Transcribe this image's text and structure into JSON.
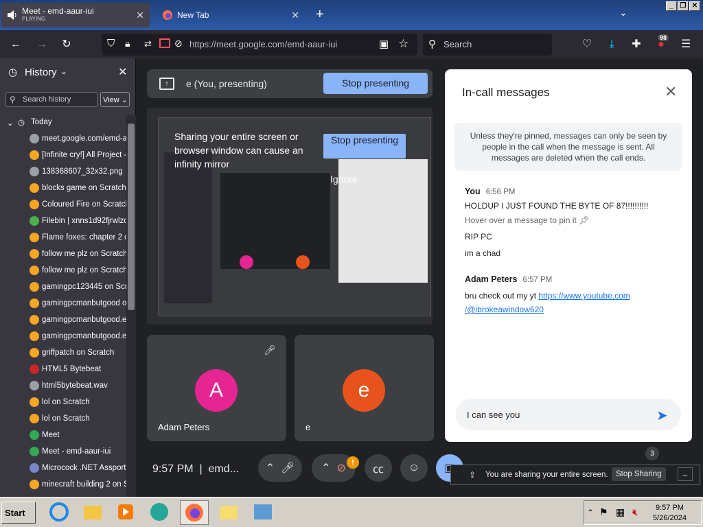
{
  "browser": {
    "tabs": [
      {
        "title": "Meet - emd-aaur-iui",
        "subtitle": "PLAYING"
      },
      {
        "title": "New Tab",
        "subtitle": ""
      }
    ],
    "url": "https://meet.google.com/emd-aaur-iui",
    "search_placeholder": "Search",
    "extension_badge": "98"
  },
  "sidebar": {
    "title": "History",
    "search_placeholder": "Search history",
    "view_label": "View",
    "group_label": "Today",
    "items": [
      {
        "label": "meet.google.com/emd-aa",
        "color": "#9aa0a6"
      },
      {
        "label": "[Infinite cry!] All Project -",
        "color": "#f5a623"
      },
      {
        "label": "138368607_32x32.png",
        "color": "#9aa0a6"
      },
      {
        "label": "blocks game on Scratch",
        "color": "#f5a623"
      },
      {
        "label": "Coloured Fire on Scratch",
        "color": "#f5a623"
      },
      {
        "label": "Filebin | xnns1d92fjrwlzo",
        "color": "#4caf50"
      },
      {
        "label": "Flame foxes: chapter 2 o",
        "color": "#f5a623"
      },
      {
        "label": "follow me plz on Scratch",
        "color": "#f5a623"
      },
      {
        "label": "follow me plz on Scratch",
        "color": "#f5a623"
      },
      {
        "label": "gamingpc123445 on Scra",
        "color": "#f5a623"
      },
      {
        "label": "gamingpcmanbutgood on",
        "color": "#f5a623"
      },
      {
        "label": "gamingpcmanbutgood.ex",
        "color": "#f5a623"
      },
      {
        "label": "gamingpcmanbutgood.ex",
        "color": "#f5a623"
      },
      {
        "label": "griffpatch on Scratch",
        "color": "#f5a623"
      },
      {
        "label": "HTML5 Bytebeat",
        "color": "#c62828"
      },
      {
        "label": "html5bytebeat.wav",
        "color": "#9aa0a6"
      },
      {
        "label": "lol on Scratch",
        "color": "#f5a623"
      },
      {
        "label": "lol on Scratch",
        "color": "#f5a623"
      },
      {
        "label": "Meet",
        "color": "#34a853"
      },
      {
        "label": "Meet - emd-aaur-iui",
        "color": "#34a853"
      },
      {
        "label": "Microcock .NET Assport:",
        "color": "#7986cb"
      },
      {
        "label": "minecraft building 2 on Sc",
        "color": "#f5a623"
      }
    ]
  },
  "meet": {
    "presenting_label": "e (You, presenting)",
    "stop_presenting": "Stop presenting",
    "warning_text": "Sharing your entire screen or browser window can cause an infinity mirror",
    "warning_stop": "Stop presenting",
    "warning_ignore": "Ignore",
    "participants": [
      {
        "name": "Adam Peters",
        "initial": "A",
        "color": "#e52592"
      },
      {
        "name": "e",
        "initial": "e",
        "color": "#e8531d"
      }
    ],
    "clock": "9:57 PM",
    "meeting_code": "emd...",
    "people_count": "3",
    "share_banner": "You are sharing your entire screen.",
    "stop_sharing": "Stop Sharing"
  },
  "chat": {
    "title": "In-call messages",
    "notice": "Unless they're pinned, messages can only be seen by people in the call when the message is sent. All messages are deleted when the call ends.",
    "messages": [
      {
        "sender": "You",
        "time": "6:56 PM",
        "lines": [
          "HOLDUP I JUST FOUND THE BYTE OF 87!!!!!!!!!!",
          "RIP PC",
          "im a chad"
        ],
        "hover": "Hover over a message to pin it"
      },
      {
        "sender": "Adam Peters",
        "time": "6:57 PM",
        "text": "bru check out my yt ",
        "link1": "https://www.youtube.com",
        "link2": "/@ibrokeawindow620"
      }
    ],
    "input_value": "I can see you"
  },
  "taskbar": {
    "start": "Start",
    "time": "9:57 PM",
    "date": "5/26/2024"
  }
}
